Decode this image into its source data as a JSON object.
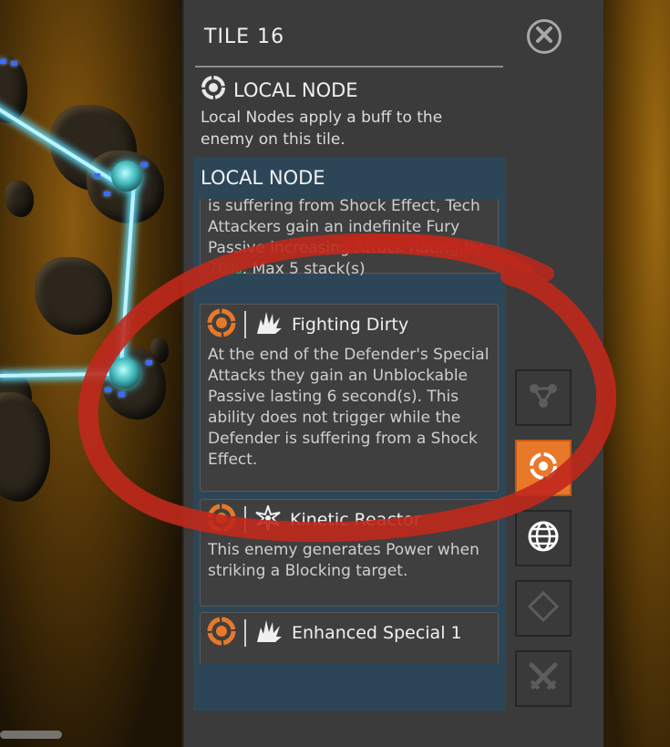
{
  "panel": {
    "tile_title": "TILE 16",
    "node_heading": "LOCAL NODE",
    "node_description": "Local Nodes apply a buff to the enemy on this tile.",
    "section_header": "LOCAL NODE"
  },
  "cards": [
    {
      "name": "",
      "text_parts": [
        "is suffering from Shock Effect, Tech Attackers gain an indefinite Fury Passive increasing Attack Rating by ",
        "70%",
        ". Max 5 stack(s)"
      ]
    },
    {
      "name": "Fighting Dirty",
      "icon": "claw-burst-icon",
      "text": "At the end of the Defender's Special Attacks they gain an Unblockable Passive lasting 6 second(s). This ability does not trigger while the Defender is suffering from a Shock Effect."
    },
    {
      "name": "Kinetic Reactor",
      "icon": "shock-star-icon",
      "text": "This enemy generates Power when striking a Blocking target."
    },
    {
      "name": "Enhanced Special 1",
      "icon": "claw-burst-icon",
      "text": ""
    }
  ],
  "side_buttons": [
    {
      "icon": "network-icon",
      "active": false
    },
    {
      "icon": "node-target-icon",
      "active": true
    },
    {
      "icon": "globe-icon",
      "active": false
    },
    {
      "icon": "diamond-icon",
      "active": false
    },
    {
      "icon": "crossed-swords-icon",
      "active": false
    }
  ],
  "colors": {
    "panel_bg": "#3b3b3b",
    "section_bg": "#2c4658",
    "accent_orange": "#e8782a",
    "buff_green": "#2fbf3f",
    "annotation_red": "#c0281c"
  }
}
